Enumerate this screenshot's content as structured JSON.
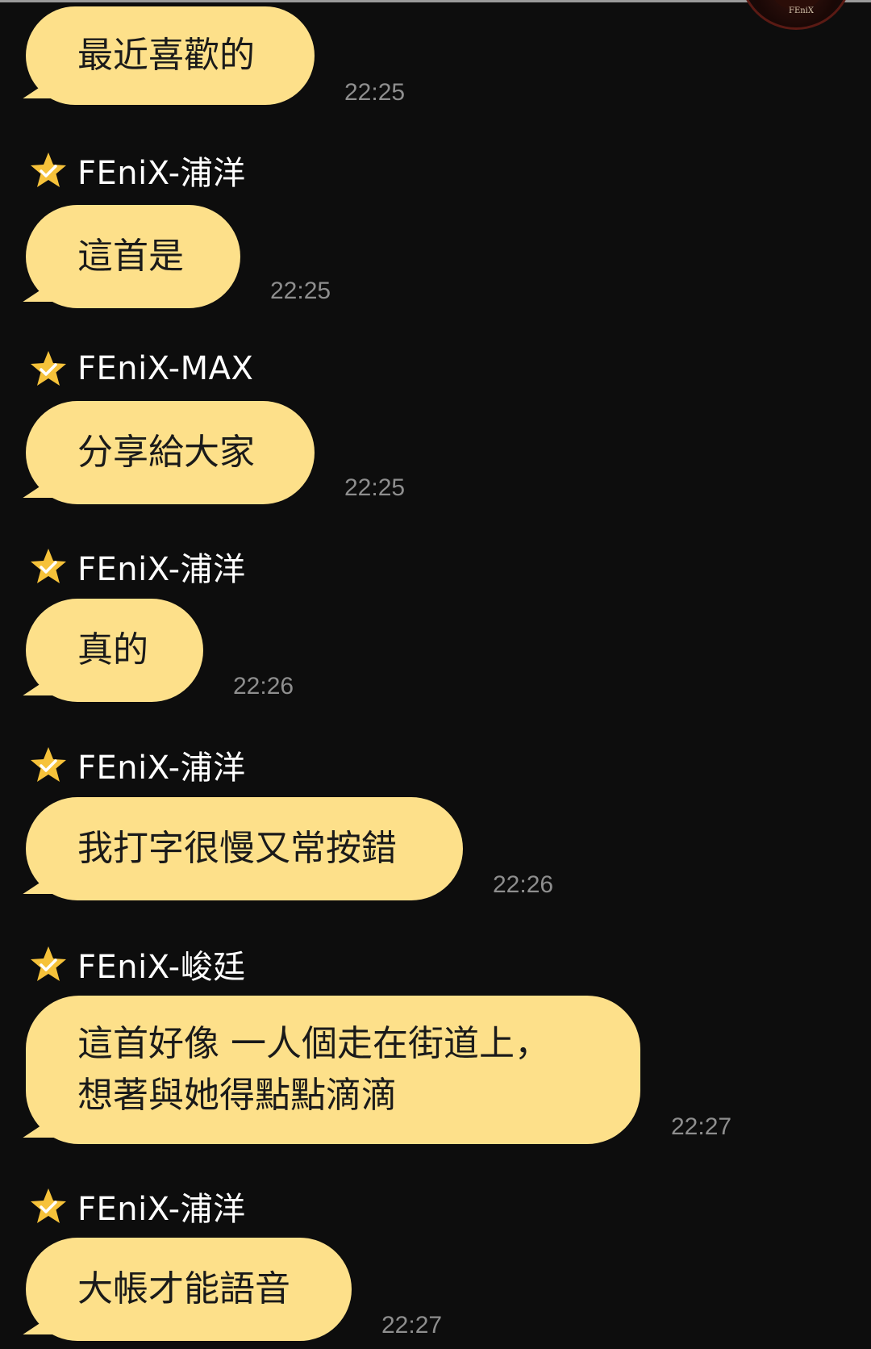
{
  "messages": [
    {
      "sender": "",
      "text": "最近喜歡的",
      "time": "22:25"
    },
    {
      "sender": "FEniX-浦洋",
      "text": "這首是",
      "time": "22:25"
    },
    {
      "sender": "FEniX-MAX",
      "text": "分享給大家",
      "time": "22:25"
    },
    {
      "sender": "FEniX-浦洋",
      "text": "真的",
      "time": "22:26"
    },
    {
      "sender": "FEniX-浦洋",
      "text": "我打字很慢又常按錯",
      "time": "22:26"
    },
    {
      "sender": "FEniX-峻廷",
      "text": "這首好像 一人個走在街道上，\n想著與她得點點滴滴",
      "time": "22:27"
    },
    {
      "sender": "FEniX-浦洋",
      "text": "大帳才能語音",
      "time": "22:27"
    }
  ],
  "icons": {
    "sender_badge": "star-check-icon",
    "avatar": "group-avatar"
  },
  "colors": {
    "background": "#0d0d0d",
    "bubble": "#fde08a",
    "bubble_text": "#1a1a1a",
    "time": "#8e8e8e",
    "star": "#f6c23a"
  }
}
